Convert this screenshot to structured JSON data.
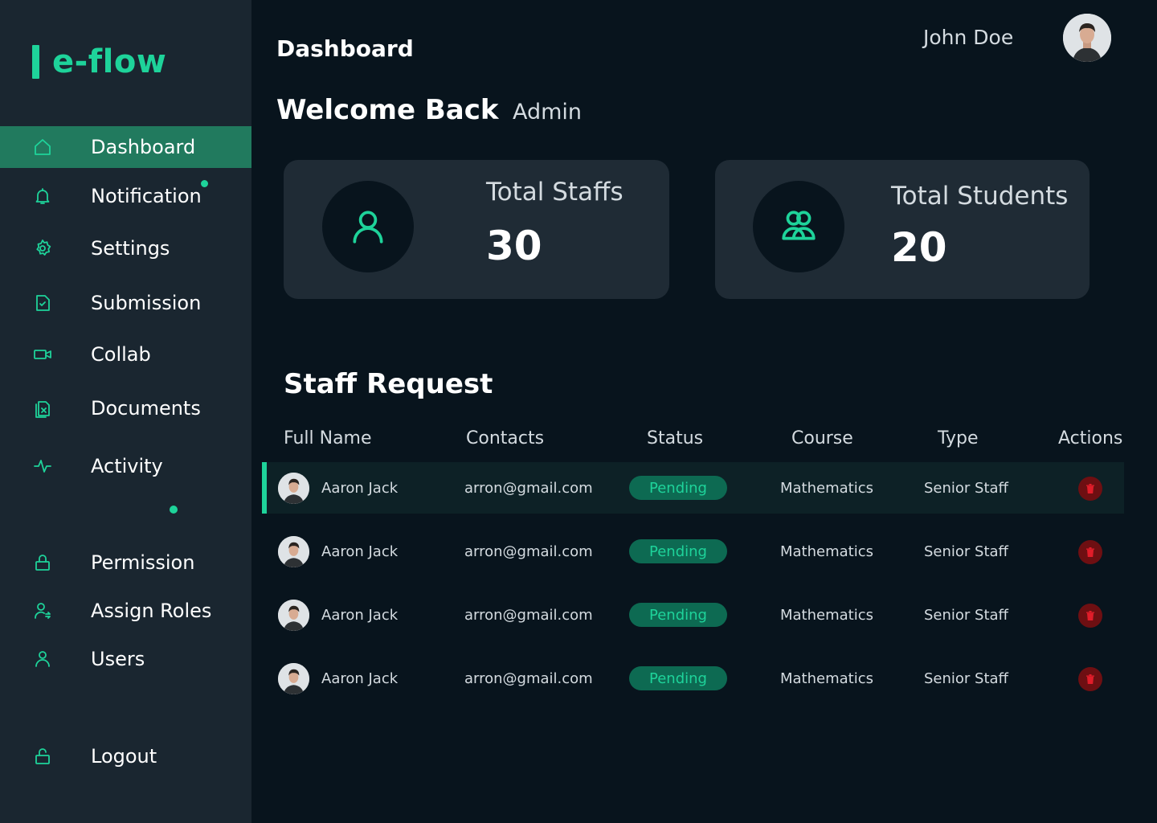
{
  "brand": {
    "name": "e-flow",
    "accent": "#1ed39a"
  },
  "sidebar": {
    "items": [
      {
        "label": "Dashboard",
        "icon": "home-icon",
        "active": true
      },
      {
        "label": "Notification",
        "icon": "bell-icon"
      },
      {
        "label": "Settings",
        "icon": "gear-icon"
      },
      {
        "label": "Submission",
        "icon": "file-check-icon"
      },
      {
        "label": "Collab",
        "icon": "video-icon"
      },
      {
        "label": "Documents",
        "icon": "documents-icon"
      },
      {
        "label": "Activity",
        "icon": "activity-icon"
      },
      {
        "label": "Permission",
        "icon": "lock-icon"
      },
      {
        "label": "Assign Roles",
        "icon": "user-assign-icon"
      },
      {
        "label": "Users",
        "icon": "user-icon"
      },
      {
        "label": "Logout",
        "icon": "unlock-icon"
      }
    ]
  },
  "header": {
    "title": "Dashboard",
    "user_name": "John Doe",
    "welcome": "Welcome Back",
    "role": "Admin"
  },
  "stats": [
    {
      "label": "Total Staffs",
      "value": "30",
      "icon": "user-icon"
    },
    {
      "label": "Total Students",
      "value": "20",
      "icon": "users-group-icon"
    }
  ],
  "staff_request": {
    "title": "Staff Request",
    "columns": [
      "Full Name",
      "Contacts",
      "Status",
      "Course",
      "Type",
      "Actions"
    ],
    "rows": [
      {
        "name": "Aaron Jack",
        "contact": "arron@gmail.com",
        "status": "Pending",
        "course": "Mathematics",
        "type": "Senior Staff"
      },
      {
        "name": "Aaron Jack",
        "contact": "arron@gmail.com",
        "status": "Pending",
        "course": "Mathematics",
        "type": "Senior Staff"
      },
      {
        "name": "Aaron Jack",
        "contact": "arron@gmail.com",
        "status": "Pending",
        "course": "Mathematics",
        "type": "Senior Staff"
      },
      {
        "name": "Aaron Jack",
        "contact": "arron@gmail.com",
        "status": "Pending",
        "course": "Mathematics",
        "type": "Senior Staff"
      }
    ]
  },
  "colors": {
    "background": "#08141d",
    "sidebar": "#1a2630",
    "card": "#1f2b35",
    "active": "#217a5e",
    "danger": "#6e0f12"
  }
}
